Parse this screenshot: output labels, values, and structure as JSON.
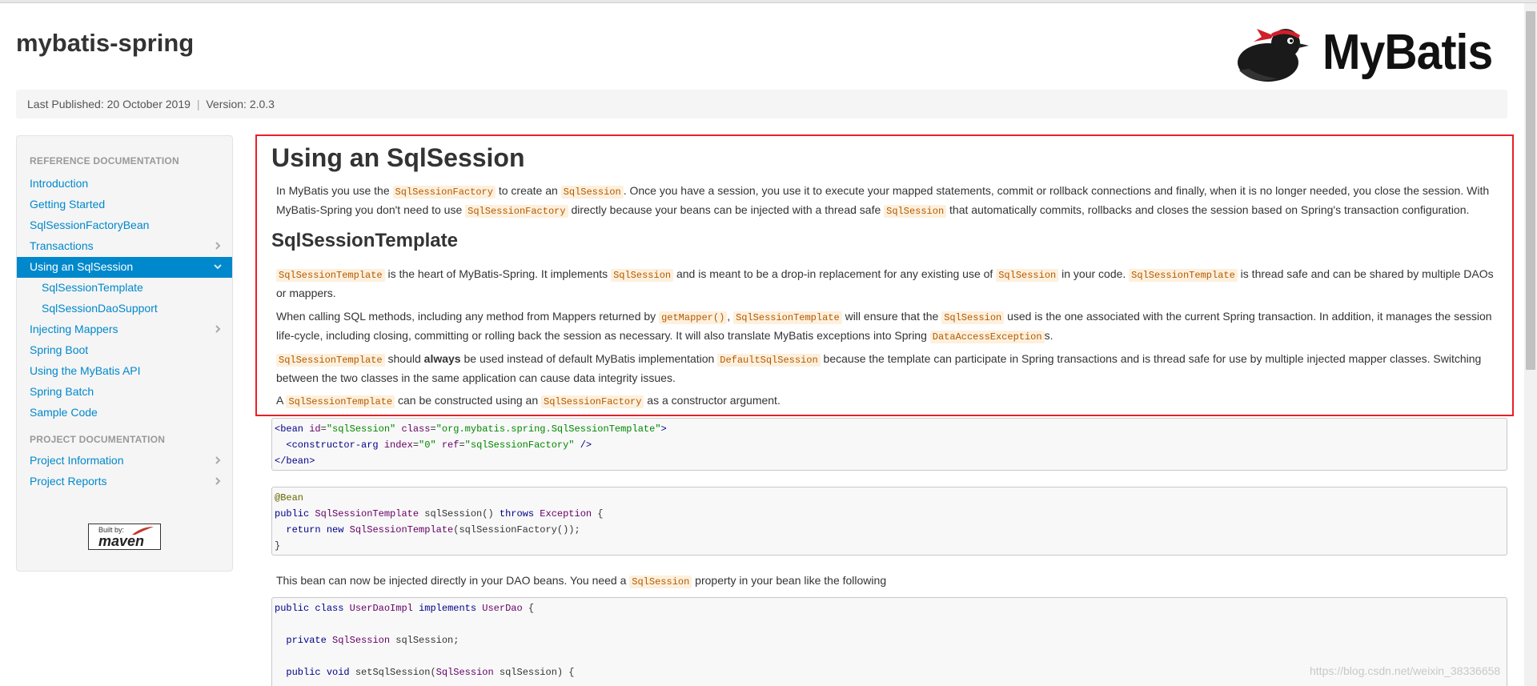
{
  "site": {
    "title": "mybatis-spring",
    "logo_text": "MyBatis",
    "published": "Last Published: 20 October 2019",
    "separator": "|",
    "version": "Version: 2.0.3"
  },
  "sidebar": {
    "header_reference": "REFERENCE DOCUMENTATION",
    "header_project": "PROJECT DOCUMENTATION",
    "items": [
      {
        "label": "Introduction"
      },
      {
        "label": "Getting Started"
      },
      {
        "label": "SqlSessionFactoryBean"
      },
      {
        "label": "Transactions"
      },
      {
        "label": "Using an SqlSession"
      },
      {
        "label": "SqlSessionTemplate"
      },
      {
        "label": "SqlSessionDaoSupport"
      },
      {
        "label": "Injecting Mappers"
      },
      {
        "label": "Spring Boot"
      },
      {
        "label": "Using the MyBatis API"
      },
      {
        "label": "Spring Batch"
      },
      {
        "label": "Sample Code"
      },
      {
        "label": "Project Information"
      },
      {
        "label": "Project Reports"
      }
    ],
    "maven_badge": {
      "by": "Built by:",
      "name": "maven"
    }
  },
  "content": {
    "heading": "Using an SqlSession",
    "intro": {
      "t1": "In MyBatis you use the ",
      "c1": "SqlSessionFactory",
      "t2": " to create an ",
      "c2": "SqlSession",
      "t3": ". Once you have a session, you use it to execute your mapped statements, commit or rollback connections and finally, when it is no longer needed, you close the session. With MyBatis-Spring you don't need to use ",
      "c3": "SqlSessionFactory",
      "t4": " directly because your beans can be injected with a thread safe ",
      "c4": "SqlSession",
      "t5": " that automatically commits, rollbacks and closes the session based on Spring's transaction configuration."
    },
    "subheading": "SqlSessionTemplate",
    "p1": {
      "c1": "SqlSessionTemplate",
      "t1": " is the heart of MyBatis-Spring. It implements ",
      "c2": "SqlSession",
      "t2": " and is meant to be a drop-in replacement for any existing use of ",
      "c3": "SqlSession",
      "t3": " in your code. ",
      "c4": "SqlSessionTemplate",
      "t4": " is thread safe and can be shared by multiple DAOs or mappers."
    },
    "p2": {
      "t1": "When calling SQL methods, including any method from Mappers returned by ",
      "c1": "getMapper()",
      "t2": ", ",
      "c2": "SqlSessionTemplate",
      "t3": " will ensure that the ",
      "c3": "SqlSession",
      "t4": " used is the one associated with the current Spring transaction. In addition, it manages the session life-cycle, including closing, committing or rolling back the session as necessary. It will also translate MyBatis exceptions into Spring ",
      "c4": "DataAccessException",
      "t5": "s."
    },
    "p3": {
      "c1": "SqlSessionTemplate",
      "t1": " should ",
      "b1": "always",
      "t2": " be used instead of default MyBatis implementation ",
      "c2": "DefaultSqlSession",
      "t3": " because the template can participate in Spring transactions and is thread safe for use by multiple injected mapper classes. Switching between the two classes in the same application can cause data integrity issues."
    },
    "p4": {
      "t1": "A ",
      "c1": "SqlSessionTemplate",
      "t2": " can be constructed using an ",
      "c2": "SqlSessionFactory",
      "t3": " as a constructor argument."
    },
    "xml_lines": [
      "<bean id=\"sqlSession\" class=\"org.mybatis.spring.SqlSessionTemplate\">",
      "  <constructor-arg index=\"0\" ref=\"sqlSessionFactory\" />",
      "</bean>"
    ],
    "java_lines": [
      "@Bean",
      "public SqlSessionTemplate sqlSession() throws Exception {",
      "  return new SqlSessionTemplate(sqlSessionFactory());",
      "}"
    ],
    "p5": {
      "t1": "This bean can now be injected directly in your DAO beans. You need a ",
      "c1": "SqlSession",
      "t2": " property in your bean like the following"
    },
    "dao_lines": [
      "public class UserDaoImpl implements UserDao {",
      "",
      "  private SqlSession sqlSession;",
      "",
      "  public void setSqlSession(SqlSession sqlSession) {"
    ]
  },
  "watermark": "https://blog.csdn.net/weixin_38336658"
}
